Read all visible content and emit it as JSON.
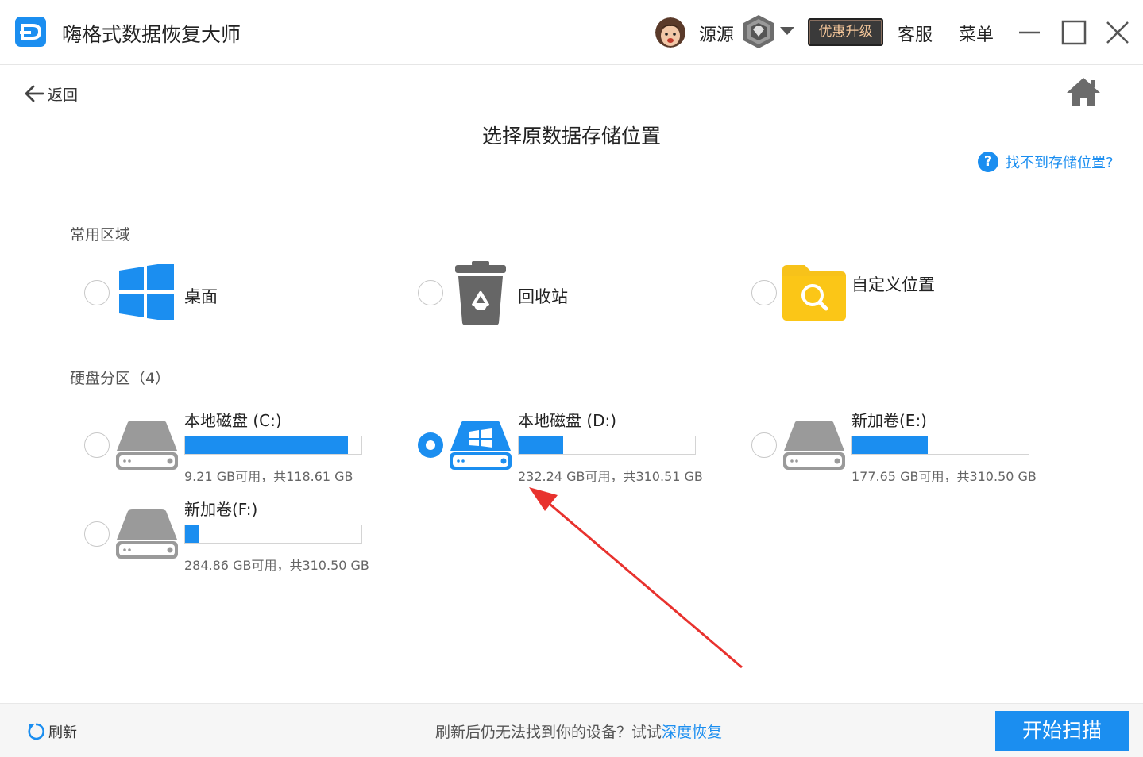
{
  "window": {
    "title": "嗨格式数据恢复大师",
    "username": "源源",
    "upgrade_label": "优惠升级",
    "service_label": "客服",
    "menu_label": "菜单"
  },
  "nav": {
    "back_label": "返回"
  },
  "page": {
    "title": "选择原数据存储位置",
    "help_link": "找不到存储位置?"
  },
  "common": {
    "section_label": "常用区域",
    "items": [
      {
        "label": "桌面",
        "icon": "windows-desktop-icon",
        "selected": false
      },
      {
        "label": "回收站",
        "icon": "recycle-bin-icon",
        "selected": false
      },
      {
        "label": "自定义位置",
        "icon": "folder-search-icon",
        "selected": false
      }
    ]
  },
  "drives": {
    "section_label": "硬盘分区（4）",
    "items": [
      {
        "name": "本地磁盘 (C:)",
        "info": "9.21 GB可用，共118.61 GB",
        "used_fraction": 0.922,
        "selected": false,
        "system": false
      },
      {
        "name": "本地磁盘 (D:)",
        "info": "232.24 GB可用，共310.51 GB",
        "used_fraction": 0.252,
        "selected": true,
        "system": true
      },
      {
        "name": "新加卷(E:)",
        "info": "177.65 GB可用，共310.50 GB",
        "used_fraction": 0.428,
        "selected": false,
        "system": false
      },
      {
        "name": "新加卷(F:)",
        "info": "284.86 GB可用，共310.50 GB",
        "used_fraction": 0.083,
        "selected": false,
        "system": false
      }
    ]
  },
  "footer": {
    "refresh_label": "刷新",
    "hint_text": "刷新后仍无法找到你的设备？试试",
    "deep_recover_label": "深度恢复",
    "start_scan_label": "开始扫描"
  },
  "colors": {
    "accent": "#1b8ef0",
    "drive_gray": "#9a9a9a",
    "folder_yellow": "#f7c21a",
    "annotation_red": "#e8322e"
  }
}
